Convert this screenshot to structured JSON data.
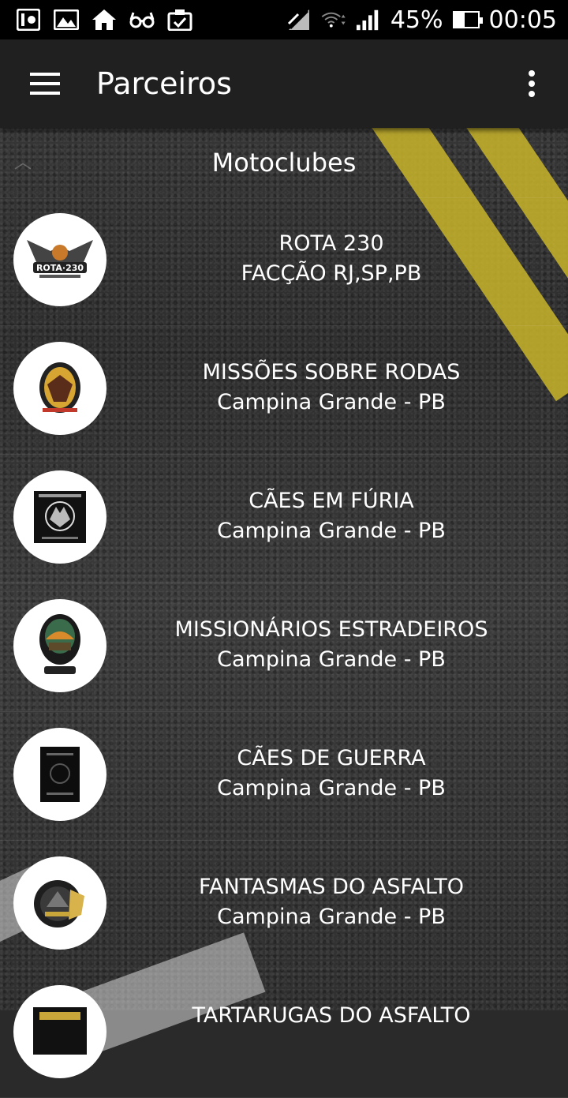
{
  "status_bar": {
    "battery": "45%",
    "time": "00:05",
    "battery_level": 0.45,
    "icons": [
      "app-icon",
      "image-icon",
      "home-icon",
      "glasses-icon",
      "clipboard-check-icon",
      "no-signal-icon",
      "wifi-icon",
      "cell-signal-icon",
      "battery-icon"
    ]
  },
  "app_bar": {
    "title": "Parceiros",
    "icons": [
      "hamburger-menu-icon",
      "overflow-menu-icon"
    ]
  },
  "section": {
    "title": "Motoclubes"
  },
  "partners": [
    {
      "name": "ROTA 230",
      "location": "FACÇÃO RJ,SP,PB"
    },
    {
      "name": "MISSÕES SOBRE RODAS",
      "location": "Campina Grande - PB"
    },
    {
      "name": "CÃES EM FÚRIA",
      "location": "Campina Grande - PB"
    },
    {
      "name": "MISSIONÁRIOS ESTRADEIROS",
      "location": "Campina Grande - PB"
    },
    {
      "name": "CÃES DE GUERRA",
      "location": "Campina Grande - PB"
    },
    {
      "name": "FANTASMAS DO ASFALTO",
      "location": "Campina Grande - PB"
    },
    {
      "name": "TARTARUGAS DO ASFALTO",
      "location": ""
    }
  ],
  "colors": {
    "app_bar": "#202020",
    "status_bar": "#000000",
    "road_stripe": "#c9b52a",
    "text": "#ffffff"
  }
}
